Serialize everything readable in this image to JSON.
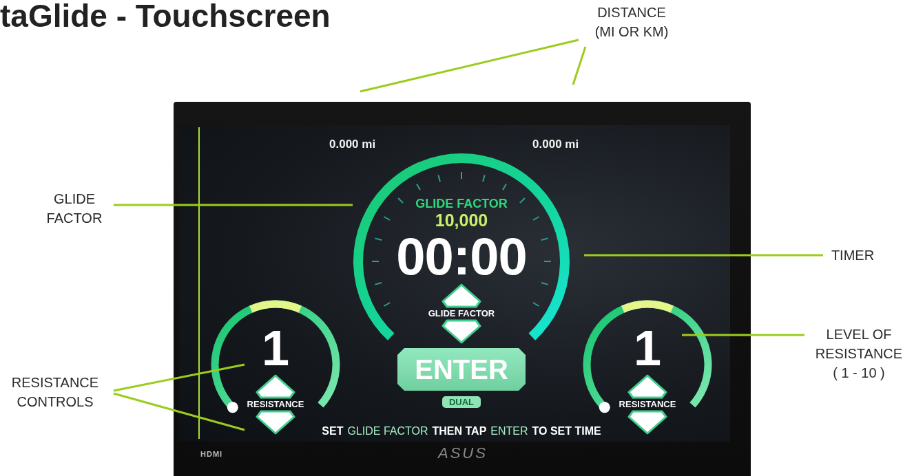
{
  "title": "taGlide - Touchscreen",
  "annotations": [
    {
      "lines": [
        "DISTANCE",
        "(MI OR KM)"
      ]
    },
    {
      "lines": [
        "GLIDE",
        "FACTOR"
      ]
    },
    {
      "lines": [
        "TIMER"
      ]
    },
    {
      "lines": [
        "LEVEL OF",
        "RESISTANCE",
        "( 1 - 10 )"
      ]
    },
    {
      "lines": [
        "RESISTANCE",
        "CONTROLS"
      ]
    }
  ],
  "screen": {
    "distances": [
      "0.000 mi",
      "0.000 mi"
    ],
    "glide_label": "GLIDE FACTOR",
    "glide_value": "10,000",
    "timer": "00:00",
    "glide_control_label": "GLIDE FACTOR",
    "enter": "ENTER",
    "mode": "DUAL",
    "instruction": [
      {
        "text": "SET",
        "highlight": false
      },
      {
        "text": "GLIDE FACTOR",
        "highlight": true
      },
      {
        "text": "THEN TAP",
        "highlight": false
      },
      {
        "text": "ENTER",
        "highlight": true
      },
      {
        "text": "TO SET TIME",
        "highlight": false
      }
    ],
    "resistance": [
      {
        "value": "1",
        "label": "RESISTANCE"
      },
      {
        "value": "1",
        "label": "RESISTANCE"
      }
    ]
  },
  "bezel": {
    "left_logo": "HDMI",
    "center_logo": "ASUS"
  }
}
